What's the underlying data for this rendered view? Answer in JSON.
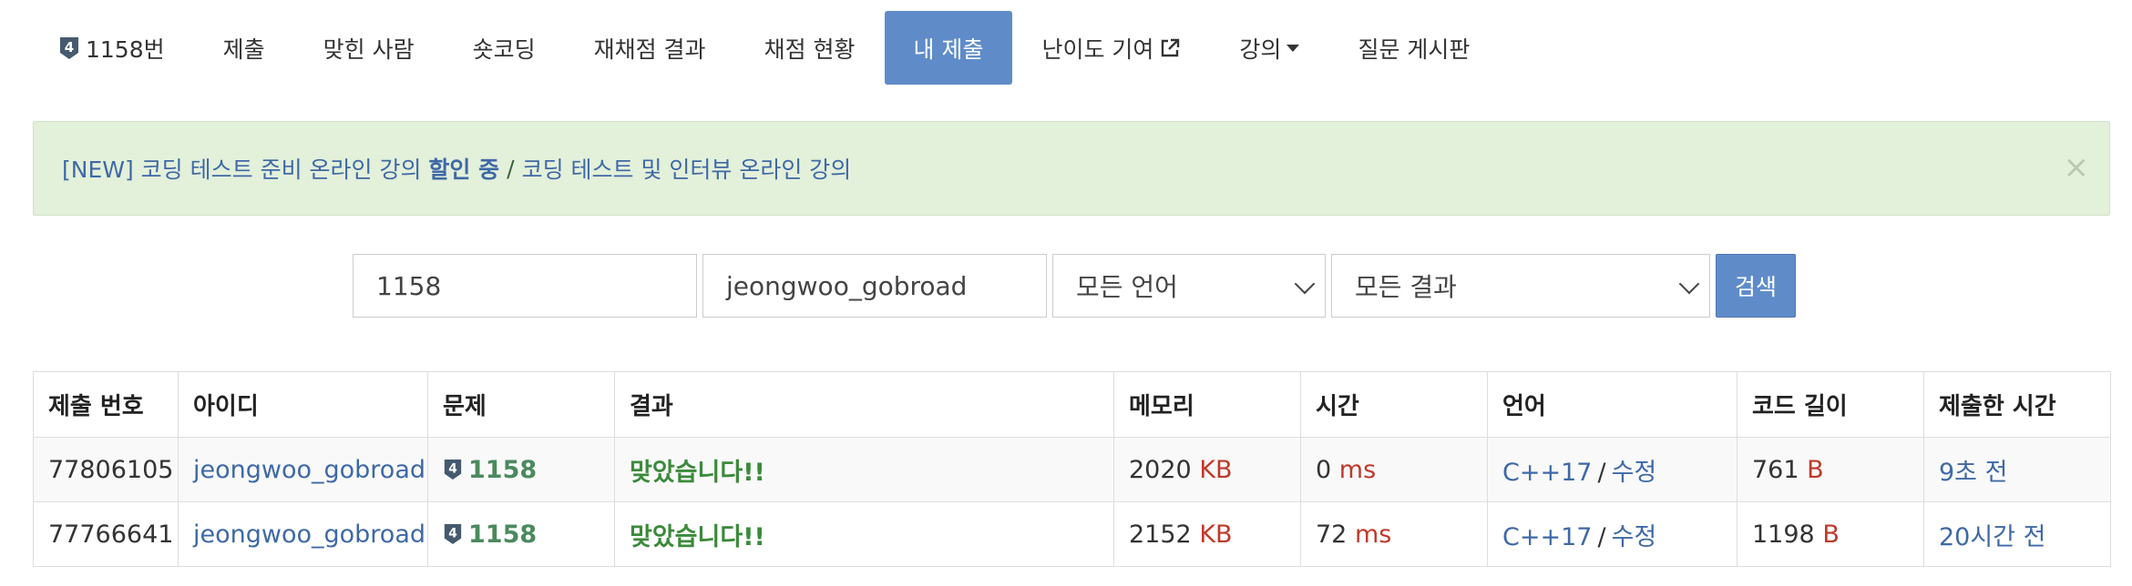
{
  "nav": {
    "problem_label": "1158번",
    "problem_tier": "4",
    "submit": "제출",
    "solvers": "맞힌 사람",
    "shortcoding": "숏코딩",
    "rejudge": "재채점 결과",
    "status": "채점 현황",
    "my_submissions": "내 제출",
    "difficulty": "난이도 기여",
    "lecture": "강의",
    "board": "질문 게시판"
  },
  "alert": {
    "part1": "[NEW] 코딩 테스트 준비 온라인 강의 ",
    "part1_strong": "할인 중",
    "separator": "/",
    "part2": "코딩 테스트 및 인터뷰 온라인 강의",
    "close": "×"
  },
  "search": {
    "problem_value": "1158",
    "user_value": "jeongwoo_gobroad",
    "language_selected": "모든 언어",
    "result_selected": "모든 결과",
    "button": "검색"
  },
  "table": {
    "headers": [
      "제출 번호",
      "아이디",
      "문제",
      "결과",
      "메모리",
      "시간",
      "언어",
      "코드 길이",
      "제출한 시간"
    ],
    "rows": [
      {
        "id": "77806105",
        "user": "jeongwoo_gobroad",
        "tier": "4",
        "problem": "1158",
        "result": "맞았습니다!!",
        "memory": "2020",
        "memory_unit": "KB",
        "time": "0",
        "time_unit": "ms",
        "language": "C++17",
        "edit": "수정",
        "length": "761",
        "length_unit": "B",
        "submitted": "9초 전"
      },
      {
        "id": "77766641",
        "user": "jeongwoo_gobroad",
        "tier": "4",
        "problem": "1158",
        "result": "맞았습니다!!",
        "memory": "2152",
        "memory_unit": "KB",
        "time": "72",
        "time_unit": "ms",
        "language": "C++17",
        "edit": "수정",
        "length": "1198",
        "length_unit": "B",
        "submitted": "20시간 전"
      }
    ]
  },
  "colors": {
    "accent": "#5f8cc9",
    "link": "#3e69a6",
    "unit": "#c0392b",
    "accepted": "#3b8a3b",
    "alert_bg": "#e3f0da",
    "tier_badge": "#455a6f"
  }
}
